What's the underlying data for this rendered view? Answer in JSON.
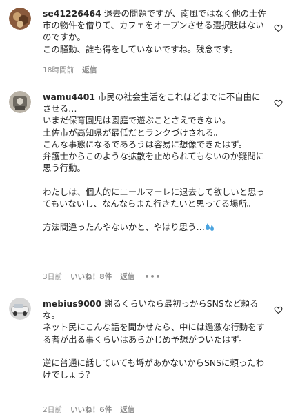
{
  "comments": [
    {
      "username": "se41226464",
      "text": "退去の問題ですが、南風ではなく他の土佐市の物件を借りて、カフェをオープンさせる選択肢はないのですか。\nこの騒動、誰も得をしていないですね。残念です。",
      "time": "18時間前",
      "likes": "",
      "reply": "返信",
      "avatar_icon": "user-avatar-icon",
      "like_icon": "heart-outline-icon"
    },
    {
      "username": "wamu4401",
      "text": "市民の社会生活をこれほどまでに不自由にさせる…\nいまだ保育園児は園庭で遊ぶことさえできない。\n土佐市が高知県が最低だとランクづけされる。\nこんな事態になるであろうは容易に想像できたはず。\n弁護士からこのような拡散を止められてもないのか疑問に思う行動。\n\nわたしは、個人的にニールマーレに退去して欲しいと思ってもいないし、なんならまた行きたいと思ってる場所。\n\n方法間違ったんやないかと、やはり思う…",
      "time": "3日前",
      "likes": "いいね！8件",
      "reply": "返信",
      "more": "•••",
      "avatar_icon": "user-avatar-icon",
      "like_icon": "heart-outline-icon",
      "emoji_icon": "sweat-drops-icon"
    },
    {
      "username": "mebius9000",
      "text": "謝るくらいなら最初っからSNSなど頼るな。\nネット民にこんな話を聞かせたら、中には過激な行動をする者が出る事くらいはあらかじめ予想がついたはず。\n\n逆に普通に話していても埒があかないからSNSに頼ったわけでしょう？",
      "time": "2日前",
      "likes": "いいね！6件",
      "reply": "返信",
      "avatar_icon": "user-avatar-icon",
      "like_icon": "heart-outline-icon"
    }
  ],
  "colors": {
    "text": "#262626",
    "meta": "#8e8e8e",
    "border": "#2b2b2b",
    "emoji": "#4aa3df"
  }
}
